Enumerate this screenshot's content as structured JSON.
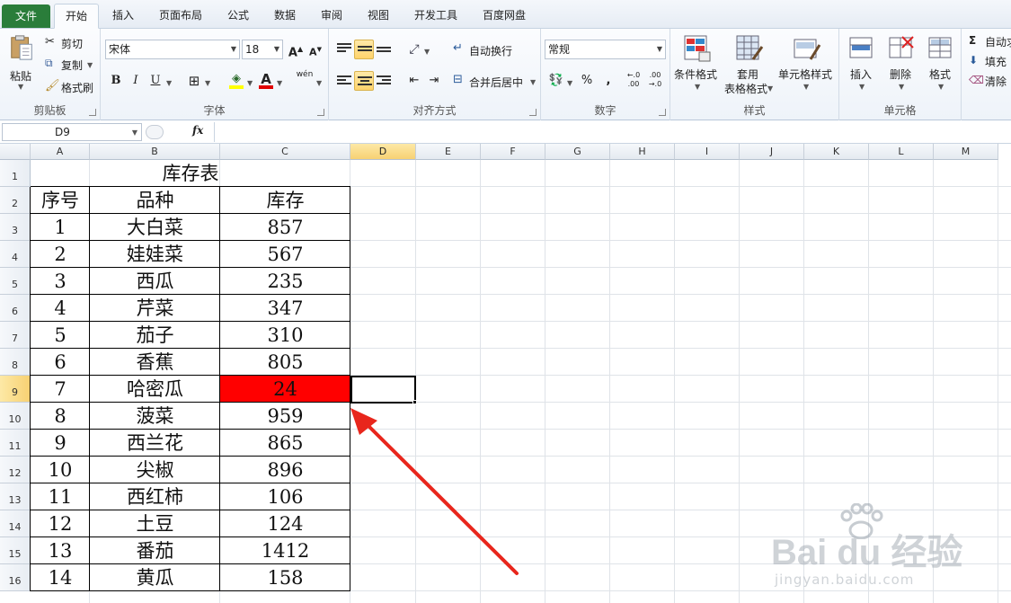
{
  "tabs": [
    "文件",
    "开始",
    "插入",
    "页面布局",
    "公式",
    "数据",
    "审阅",
    "视图",
    "开发工具",
    "百度网盘"
  ],
  "clipboard": {
    "paste": "粘贴",
    "cut": "剪切",
    "copy": "复制",
    "format_painter": "格式刷",
    "label": "剪贴板"
  },
  "font": {
    "name": "宋体",
    "size": "18",
    "grow": "A",
    "shrink": "A",
    "bold": "B",
    "italic": "I",
    "underline": "U",
    "label": "字体",
    "phonetic": "wén"
  },
  "alignment": {
    "wrap": "自动换行",
    "merge": "合并后居中",
    "label": "对齐方式"
  },
  "number": {
    "format": "常规",
    "percent": "%",
    "comma": ",",
    "inc": "←.0 .00",
    "dec": ".00 →.0",
    "label": "数字"
  },
  "styles": {
    "conditional": "条件格式",
    "table_top": "套用",
    "table_bottom": "表格格式",
    "cell_styles": "单元格样式",
    "label": "样式"
  },
  "cells": {
    "insert": "插入",
    "delete": "删除",
    "format": "格式",
    "label": "单元格"
  },
  "editing": {
    "autosum": "自动求",
    "fill": "填充",
    "clear": "清除"
  },
  "formula_bar": {
    "name_box": "D9",
    "fx": "fx",
    "formula": ""
  },
  "columns": [
    "A",
    "B",
    "C",
    "D",
    "E",
    "F",
    "G",
    "H",
    "I",
    "J",
    "K",
    "L",
    "M"
  ],
  "rows": [
    "1",
    "2",
    "3",
    "4",
    "5",
    "6",
    "7",
    "8",
    "9",
    "10",
    "11",
    "12",
    "13",
    "14",
    "15",
    "16"
  ],
  "sheet": {
    "title": "库存表",
    "headers": [
      "序号",
      "品种",
      "库存"
    ],
    "data": [
      [
        "1",
        "大白菜",
        "857"
      ],
      [
        "2",
        "娃娃菜",
        "567"
      ],
      [
        "3",
        "西瓜",
        "235"
      ],
      [
        "4",
        "芹菜",
        "347"
      ],
      [
        "5",
        "茄子",
        "310"
      ],
      [
        "6",
        "香蕉",
        "805"
      ],
      [
        "7",
        "哈密瓜",
        "24"
      ],
      [
        "8",
        "菠菜",
        "959"
      ],
      [
        "9",
        "西兰花",
        "865"
      ],
      [
        "10",
        "尖椒",
        "896"
      ],
      [
        "11",
        "西红柿",
        "106"
      ],
      [
        "12",
        "土豆",
        "124"
      ],
      [
        "13",
        "番茄",
        "1412"
      ],
      [
        "14",
        "黄瓜",
        "158"
      ]
    ]
  },
  "selected_cell": "D9",
  "highlight_color": "#ff0000",
  "watermark": {
    "brand": "Bai du 经验",
    "url": "jingyan.baidu.com"
  }
}
